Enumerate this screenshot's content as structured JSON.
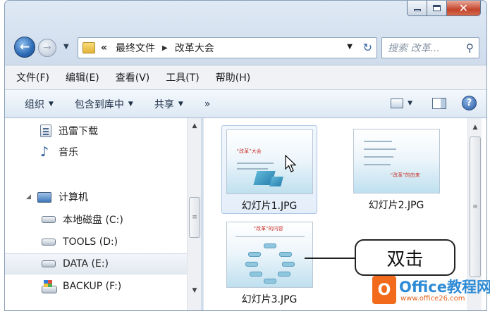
{
  "address": {
    "overflow_chevron": "«",
    "crumbs": [
      "最终文件",
      "改革大会"
    ]
  },
  "search": {
    "placeholder": "搜索 改革..."
  },
  "menu": [
    "文件(F)",
    "编辑(E)",
    "查看(V)",
    "工具(T)",
    "帮助(H)"
  ],
  "toolbar": {
    "organize": "组织",
    "include_in_library": "包含到库中",
    "share": "共享",
    "more": "»"
  },
  "nav": {
    "items": [
      {
        "label": "迅雷下载",
        "icon": "download-folder-icon"
      },
      {
        "label": "音乐",
        "icon": "music-icon"
      },
      {
        "label": "计算机",
        "icon": "computer-icon"
      },
      {
        "label": "本地磁盘 (C:)",
        "icon": "drive-icon"
      },
      {
        "label": "TOOLS (D:)",
        "icon": "drive-icon"
      },
      {
        "label": "DATA (E:)",
        "icon": "drive-icon",
        "selected": true
      },
      {
        "label": "BACKUP (F:)",
        "icon": "backup-drive-icon"
      }
    ]
  },
  "files": [
    {
      "name": "幻灯片1.JPG",
      "thumb_title": "“改革”大会",
      "selected": true
    },
    {
      "name": "幻灯片2.JPG",
      "thumb_title": "“改革”的由来"
    },
    {
      "name": "幻灯片3.JPG",
      "thumb_title": "“改革”的内容"
    }
  ],
  "callout": {
    "text": "双击"
  },
  "watermark": {
    "title": "Office教程网",
    "url": "www.office26.com"
  },
  "colors": {
    "accent": "#2c6ab5",
    "callout_border": "#222222",
    "watermark_orange": "#f26a1c"
  }
}
